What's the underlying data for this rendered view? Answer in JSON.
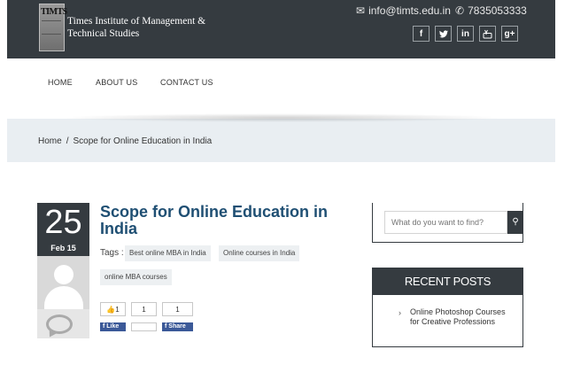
{
  "header": {
    "logo_badge": "TIMTS",
    "logo_title": "Times Institute of Management & Technical Studies",
    "email": "info@timts.edu.in",
    "phone": "7835053333",
    "social": [
      {
        "icon": "facebook-icon",
        "glyph": "f"
      },
      {
        "icon": "twitter-icon",
        "glyph": "🐦"
      },
      {
        "icon": "linkedin-icon",
        "glyph": "in"
      },
      {
        "icon": "youtube-icon",
        "glyph": "▶"
      },
      {
        "icon": "google-plus-icon",
        "glyph": "g+"
      }
    ]
  },
  "nav": {
    "items": [
      "HOME",
      "ABOUT US",
      "CONTACT US"
    ]
  },
  "breadcrumb": {
    "home": "Home",
    "separator": "/",
    "current": "Scope for Online Education in India"
  },
  "post": {
    "day": "25",
    "month": "Feb 15",
    "title": "Scope for Online Education in India",
    "tags_label": "Tags :",
    "tags": [
      "Best online MBA in India",
      "Online courses in India",
      "online MBA courses"
    ],
    "share": {
      "like_count": "1",
      "middle_count": "1",
      "share_count": "1",
      "like_label": "Like",
      "share_label": "Share"
    }
  },
  "sidebar": {
    "search_placeholder": "What do you want to find?",
    "recent_title": "RECENT POSTS",
    "recent_items": [
      "Online Photoshop Courses for Creative Professions"
    ]
  },
  "colors": {
    "dark": "#353b40",
    "title_blue": "#1f4f73",
    "facebook": "#3b5998",
    "band": "#e9eef2"
  }
}
